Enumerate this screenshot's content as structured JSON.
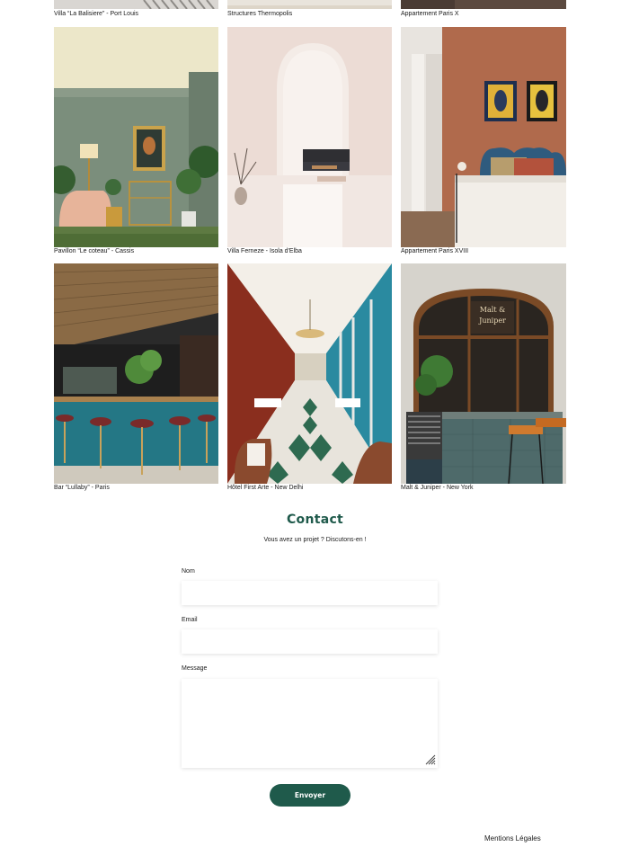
{
  "gallery": {
    "projects": [
      {
        "caption": "Villa “La Balisiere” - Port Louis"
      },
      {
        "caption": "Structures Thermopolis"
      },
      {
        "caption": "Appartement Paris X"
      },
      {
        "caption": "Pavillon “Le coteau” - Cassis"
      },
      {
        "caption": "Villa Ferneze - Isola d'Elba"
      },
      {
        "caption": "Appartement Paris XVIII"
      },
      {
        "caption": "Bar “Lullaby” - Paris"
      },
      {
        "caption": "Hôtel First Arte - New Delhi"
      },
      {
        "caption": "Malt & Juniper - New York"
      }
    ],
    "signage_text": "Malt & Juniper"
  },
  "contact": {
    "title": "Contact",
    "subtitle": "Vous avez un projet ? Discutons-en !",
    "name_label": "Nom",
    "name_value": "",
    "email_label": "Email",
    "email_value": "",
    "message_label": "Message",
    "message_value": "",
    "submit_label": "Envoyer"
  },
  "footer": {
    "legal_link": "Mentions Légales"
  },
  "colors": {
    "brand": "#1f5a4b",
    "background": "#ffffff"
  }
}
